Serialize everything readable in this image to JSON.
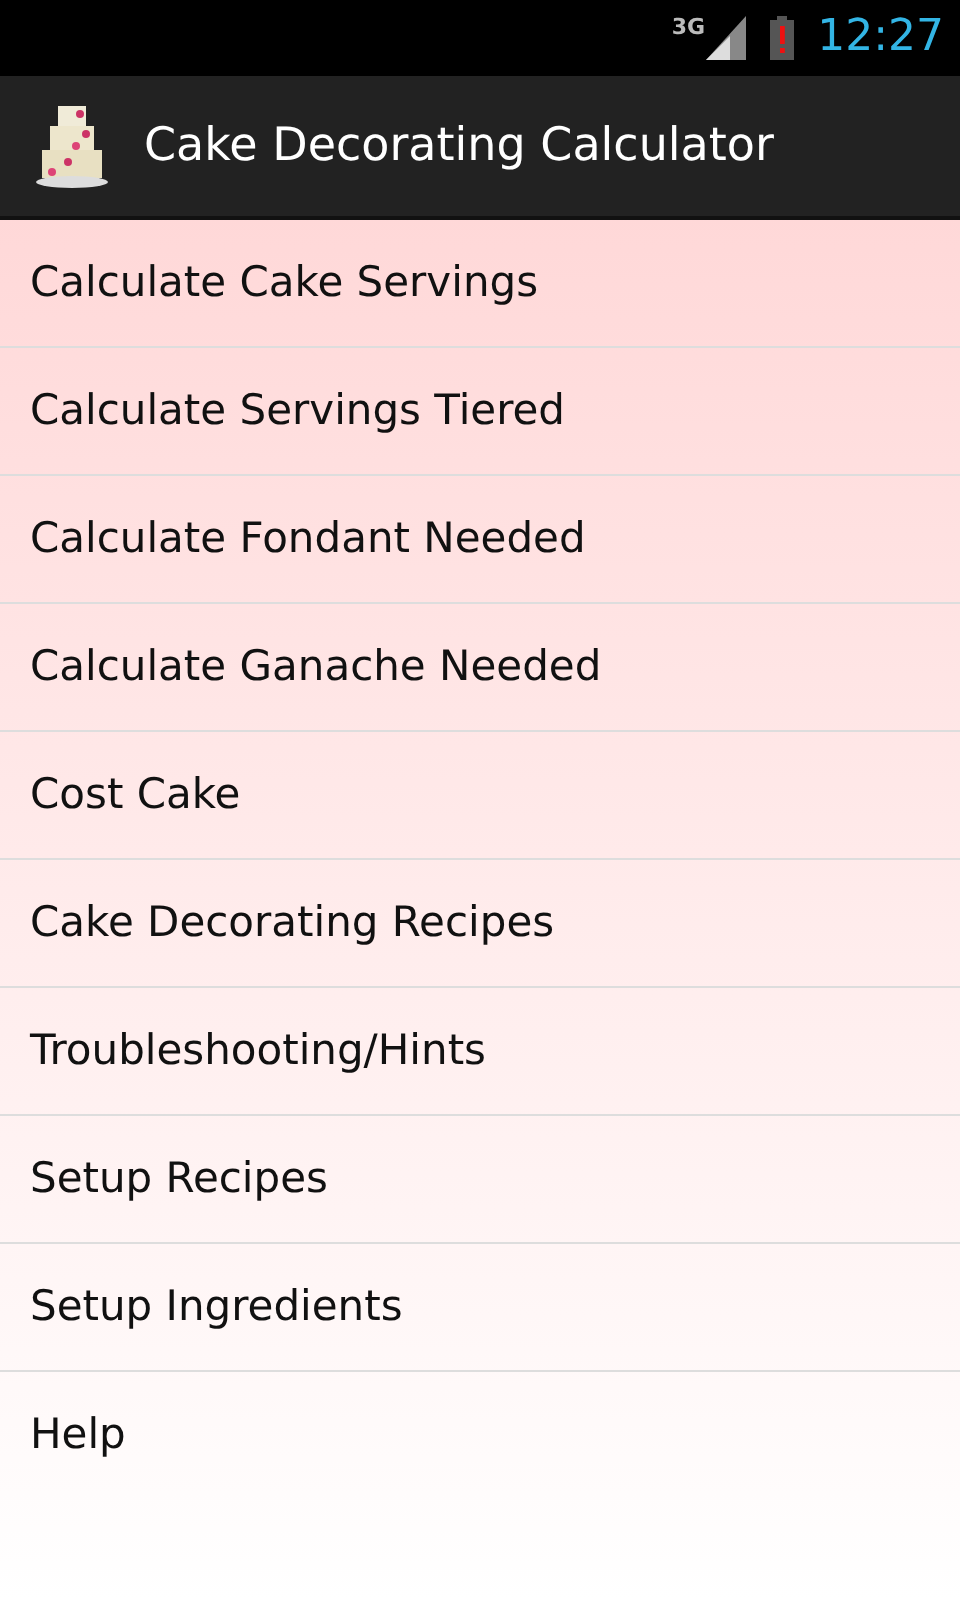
{
  "status_bar": {
    "network": "3G",
    "time": "12:27"
  },
  "action_bar": {
    "title": "Cake Decorating Calculator"
  },
  "menu": [
    {
      "label": "Calculate Cake Servings"
    },
    {
      "label": "Calculate Servings Tiered"
    },
    {
      "label": "Calculate Fondant Needed"
    },
    {
      "label": "Calculate Ganache Needed"
    },
    {
      "label": "Cost Cake"
    },
    {
      "label": "Cake Decorating Recipes"
    },
    {
      "label": "Troubleshooting/Hints"
    },
    {
      "label": "Setup Recipes"
    },
    {
      "label": "Setup Ingredients"
    },
    {
      "label": "Help"
    }
  ]
}
